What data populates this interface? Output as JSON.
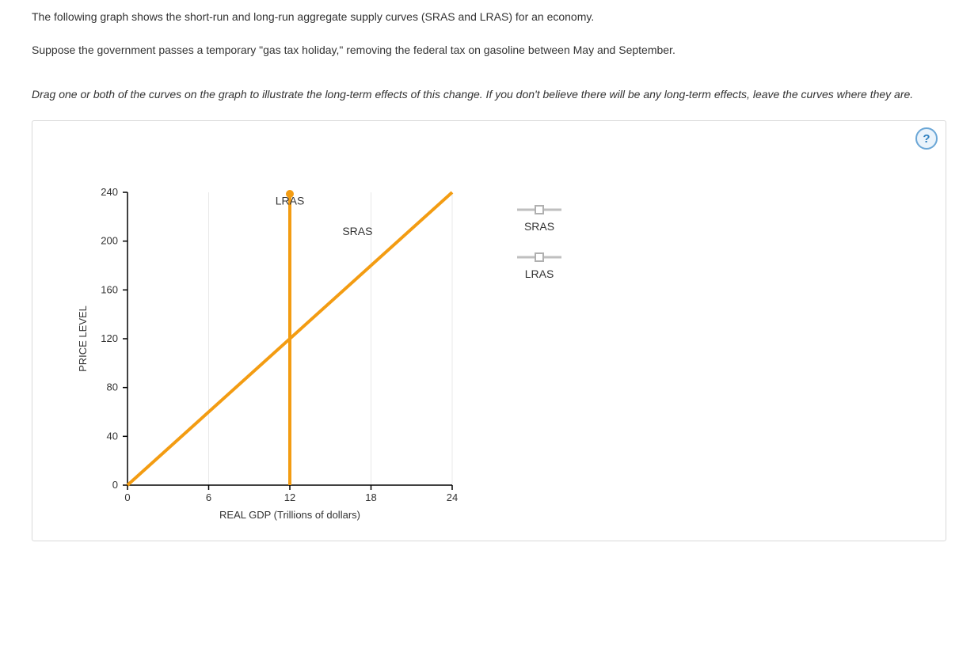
{
  "intro": {
    "p1": "The following graph shows the short-run and long-run aggregate supply curves (SRAS and LRAS) for an economy.",
    "p2": "Suppose the government passes a temporary \"gas tax holiday,\" removing the federal tax on gasoline between May and September."
  },
  "instructions": "Drag one or both of the curves on the graph to illustrate the long-term effects of this change. If you don't believe there will be any long-term effects, leave the curves where they are.",
  "help_symbol": "?",
  "legend": {
    "sras": "SRAS",
    "lras": "LRAS"
  },
  "chart_data": {
    "type": "line",
    "xlabel": "REAL GDP (Trillions of dollars)",
    "ylabel": "PRICE LEVEL",
    "xlim": [
      0,
      24
    ],
    "ylim": [
      0,
      240
    ],
    "xticks": [
      0,
      6,
      12,
      18,
      24
    ],
    "yticks": [
      0,
      40,
      80,
      120,
      160,
      200,
      240
    ],
    "series": [
      {
        "name": "SRAS",
        "label_at": {
          "x": 17,
          "y": 205
        },
        "x": [
          0,
          24
        ],
        "y": [
          0,
          240
        ],
        "color": "#f39c12"
      },
      {
        "name": "LRAS",
        "label_at": {
          "x": 12,
          "y": 230
        },
        "vertical_x": 12,
        "color": "#f39c12"
      }
    ]
  }
}
